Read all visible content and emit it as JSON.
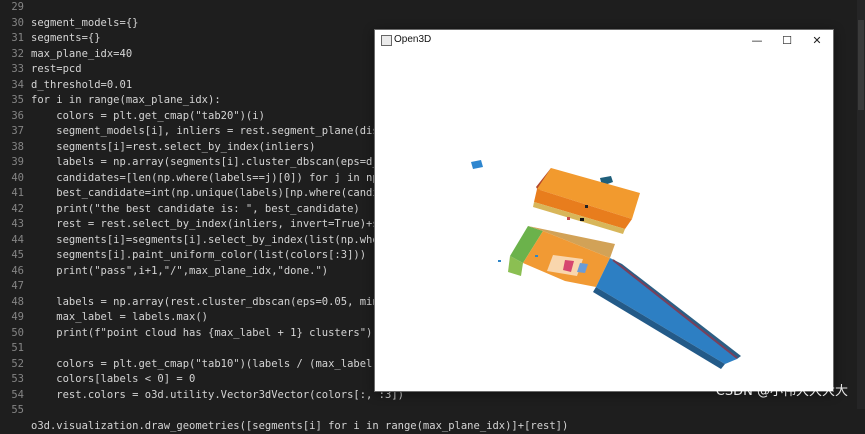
{
  "editor": {
    "line_numbers": [
      "29",
      "30",
      "31",
      "32",
      "33",
      "34",
      "35",
      "36",
      "37",
      "38",
      "39",
      "40",
      "41",
      "42",
      "43",
      "44",
      "45",
      "46",
      "47",
      "48",
      "49",
      "50",
      "51",
      "52",
      "53",
      "54",
      "55"
    ],
    "lines": [
      "",
      "segment_models={}",
      "segments={}",
      "max_plane_idx=40",
      "rest=pcd",
      "d_threshold=0.01",
      "for i in range(max_plane_idx):",
      "    colors = plt.get_cmap(\"tab20\")(i)",
      "    segment_models[i], inliers = rest.segment_plane(distanc",
      "    segments[i]=rest.select_by_index(inliers)",
      "    labels = np.array(segments[i].cluster_dbscan(eps=d_thre",
      "    candidates=[len(np.where(labels==j)[0]) for j in np.uni",
      "    best_candidate=int(np.unique(labels)[np.where(candidate",
      "    print(\"the best candidate is: \", best_candidate)",
      "    rest = rest.select_by_index(inliers, invert=True)+segme",
      "    segments[i]=segments[i].select_by_index(list(np.where(l",
      "    segments[i].paint_uniform_color(list(colors[:3]))",
      "    print(\"pass\",i+1,\"/\",max_plane_idx,\"done.\")",
      "",
      "    labels = np.array(rest.cluster_dbscan(eps=0.05, min_poi",
      "    max_label = labels.max()",
      "    print(f\"point cloud has {max_label + 1} clusters\")",
      "",
      "    colors = plt.get_cmap(\"tab10\")(labels / (max_label if m",
      "    colors[labels < 0] = 0",
      "    rest.colors = o3d.utility.Vector3dVector(colors[:, :3])",
      "",
      "o3d.visualization.draw_geometries([segments[i] for i in range(max_plane_idx)]+[rest])"
    ]
  },
  "window": {
    "title": "Open3D",
    "minimize_glyph": "—",
    "maximize_glyph": "☐",
    "close_glyph": "✕"
  },
  "watermark": "CSDN @小伟大大大大",
  "colors": {
    "editor_bg": "#1e1e1e",
    "orange_segment": "#f0912a",
    "blue_segment": "#2f86c8",
    "green_segment": "#6bb24b"
  }
}
